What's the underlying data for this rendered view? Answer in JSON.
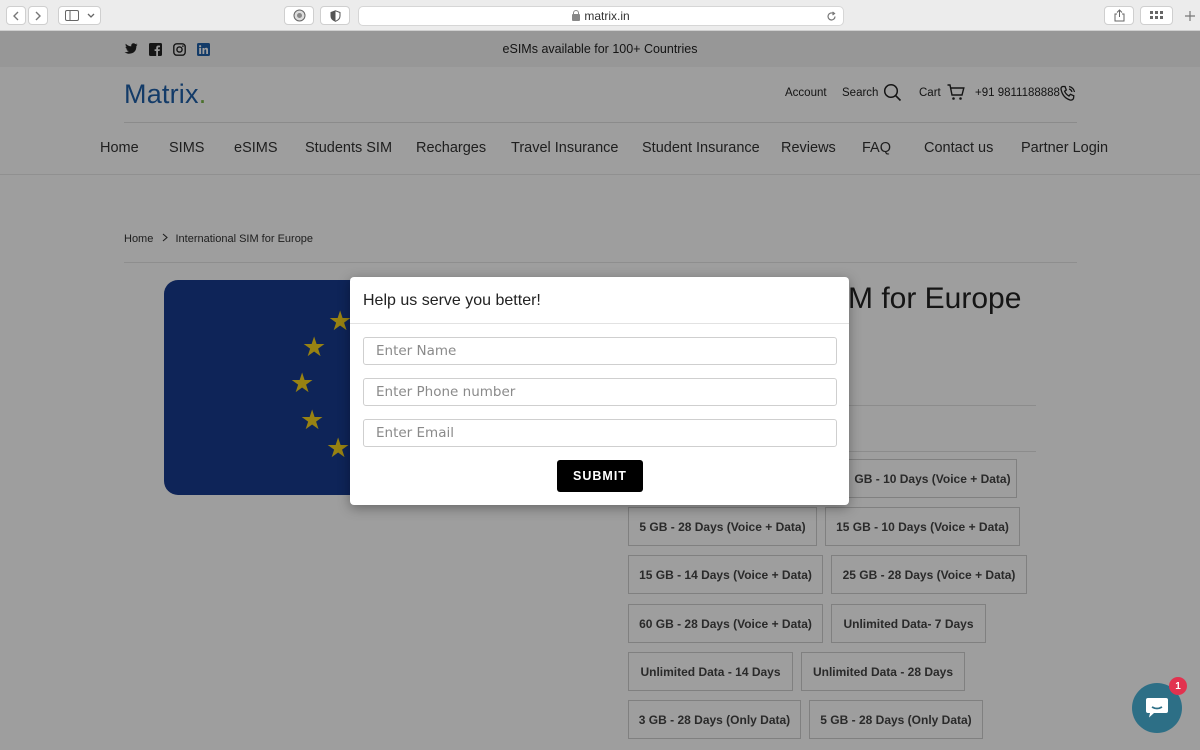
{
  "browser": {
    "url": "matrix.in"
  },
  "announcement": {
    "text": "eSIMs available for 100+ Countries"
  },
  "header": {
    "logo": "Matrix",
    "account": "Account",
    "search": "Search",
    "cart": "Cart",
    "phone": "+91 9811188888"
  },
  "nav": {
    "items": [
      "Home",
      "SIMS",
      "eSIMS",
      "Students SIM",
      "Recharges",
      "Travel Insurance",
      "Student Insurance",
      "Reviews",
      "FAQ",
      "Contact us",
      "Partner Login"
    ]
  },
  "breadcrumb": {
    "home": "Home",
    "current": "International SIM for Europe"
  },
  "product": {
    "title_visible": "M for Europe",
    "variants": [
      "GB - 10 Days (Voice + Data)",
      "5 GB - 28 Days (Voice + Data)",
      "15 GB - 10 Days (Voice + Data)",
      "15 GB - 14 Days (Voice + Data)",
      "25 GB - 28 Days (Voice + Data)",
      "60 GB - 28 Days (Voice + Data)",
      "Unlimited Data- 7 Days",
      "Unlimited Data - 14 Days",
      "Unlimited Data - 28 Days",
      "3 GB - 28 Days (Only Data)",
      "5 GB - 28 Days (Only Data)"
    ]
  },
  "modal": {
    "title": "Help us serve you better!",
    "name_placeholder": "Enter Name",
    "phone_placeholder": "Enter Phone number",
    "email_placeholder": "Enter Email",
    "submit_label": "SUBMIT"
  },
  "chat": {
    "badge_count": "1"
  },
  "colors": {
    "brand_blue": "#1f5fa8",
    "flag_blue": "#173a8f",
    "star_yellow": "#f6d21e",
    "chat_teal": "#2d6f86",
    "badge_red": "#e2324f"
  }
}
